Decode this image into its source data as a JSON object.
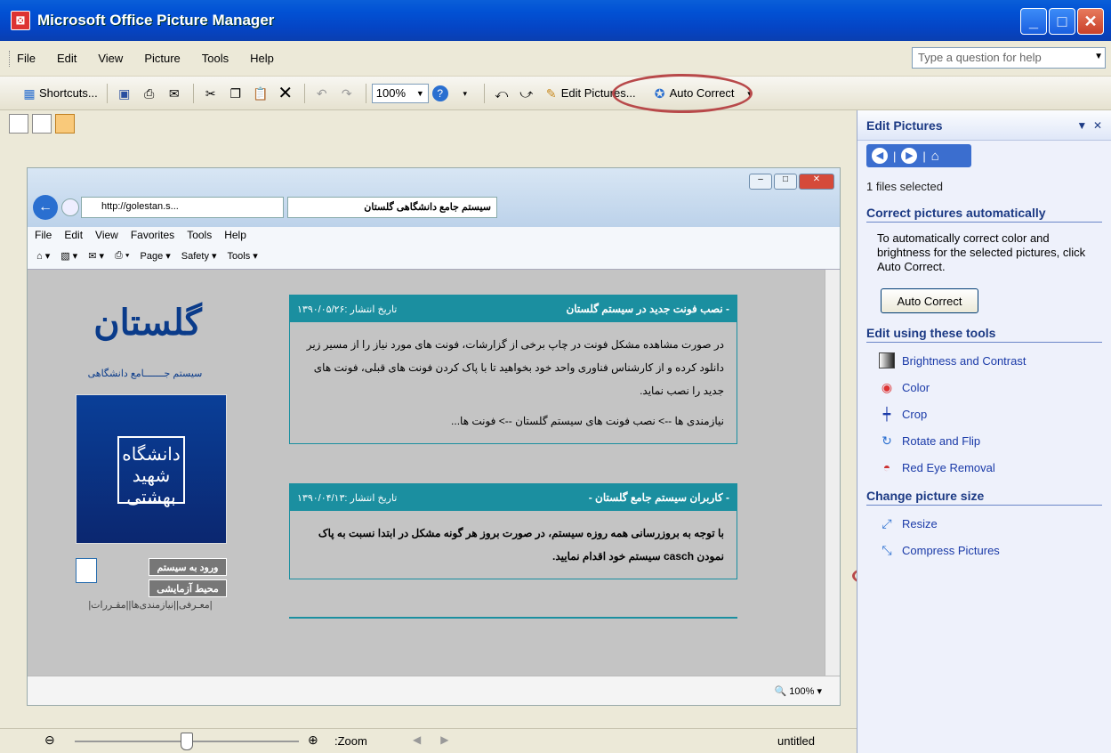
{
  "window": {
    "title": "Microsoft Office Picture Manager",
    "app_icon": "picture-manager-icon"
  },
  "menu": {
    "items": [
      "File",
      "Edit",
      "View",
      "Picture",
      "Tools",
      "Help"
    ],
    "help_placeholder": "Type a question for help"
  },
  "toolbar": {
    "shortcuts": "Shortcuts...",
    "zoom_value": "100%",
    "edit_pictures": "Edit Pictures...",
    "auto_correct": "Auto Correct"
  },
  "browser": {
    "address": "http://golestan.s...",
    "tab_title": "سیستم جامع دانشگاهی گلستان",
    "menu": [
      "File",
      "Edit",
      "View",
      "Favorites",
      "Tools",
      "Help"
    ],
    "commands": [
      "Page ▾",
      "Safety ▾",
      "Tools ▾"
    ],
    "status_zoom": "100%",
    "logo_text": "گلستان",
    "logo_sub": "سیستم جـــــــامع دانشگاهی",
    "emblem_text": "دانشگاه شهید بهشتی",
    "login_btn": "ورود به سیستم",
    "demo_btn": "محیط آزمایشی",
    "side_links": "|معـرفی||نیازمندی‌ها||مقـررات|",
    "news": [
      {
        "title": "- نصب فونت جدید در سیستم گلستان",
        "date": "تاریخ انتشار :۱۳۹۰/۰۵/۲۶",
        "body": "در صورت مشاهده مشکل فونت در چاپ برخی از گزارشات، فونت های مورد نیاز را از مسیر زیر دانلود کرده و از کارشناس فناوری واحد خود بخواهید تا با پاک کردن فونت های قبلی، فونت های جدید را نصب نماید.",
        "path": "نیازمندی ها --> نصب فونت های سیستم گلستان --> فونت ها..."
      },
      {
        "title": "- کاربران سیستم جامع گلستان -",
        "date": "تاریخ انتشار :۱۳۹۰/۰۴/۱۳",
        "body": "با توجه به بروزرسانی همه روزه سیستم، در صورت بروز هر گونه مشکل در ابتدا نسبت به پاک نمودن casch سیستم خود اقدام نمایید."
      }
    ]
  },
  "zoombar": {
    "label": ":Zoom",
    "filename": "untitled",
    "zoom_level": 0.5
  },
  "pane": {
    "title": "Edit Pictures",
    "files_selected": "1 files selected",
    "auto_heading": "Correct pictures automatically",
    "auto_desc": "To automatically correct color and brightness for the selected pictures, click Auto Correct.",
    "auto_button": "Auto Correct",
    "tools_heading": "Edit using these tools",
    "tools": [
      "Brightness and Contrast",
      "Color",
      "Crop",
      "Rotate and Flip",
      "Red Eye Removal"
    ],
    "size_heading": "Change picture size",
    "size_tools": [
      "Resize",
      "Compress Pictures"
    ]
  },
  "colors": {
    "title_bar": "#0151d4",
    "annotation": "#b8494a",
    "news_header": "#1b8fa0",
    "pane_link": "#1a3aa8"
  }
}
